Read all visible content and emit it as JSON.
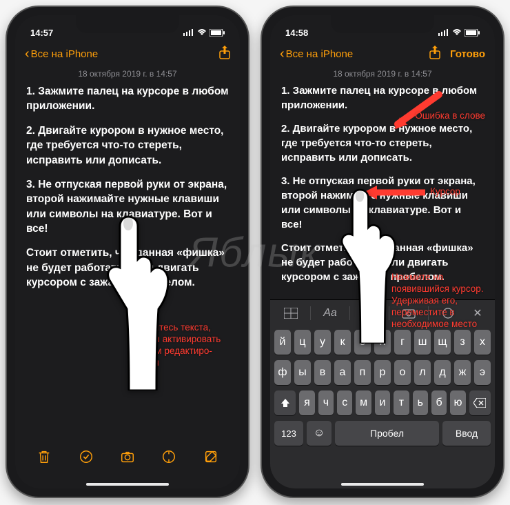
{
  "status": {
    "time1": "14:57",
    "time2": "14:58"
  },
  "nav": {
    "back": "Все на iPhone",
    "done": "Готово"
  },
  "note": {
    "date": "18 октября 2019 г. в 14:57",
    "p1": "1. Зажмите палец на курсоре в любом приложении.",
    "p2": "2. Двигайте курором в нужное место, где требуется что-то стереть, исправить или дописать.",
    "p3": "3. Не отпуская первой руки от экрана, второй нажимайте нужные клавиши или символы на клавиатуре. Вот и все!",
    "p4": "Стоит отметить, что данная «фишка» не будет работать, если двигать курсором с зажатым пробелом."
  },
  "anno": {
    "left": "Коснитесь текста, чтобы активировать режим редактиро-\nвания",
    "err": "Ошибка в слове",
    "cur": "Курсор",
    "right": "Нажмите на появившийся курсор. Удерживая его, переместите в необходимое место"
  },
  "keyboard": {
    "row1": [
      "й",
      "ц",
      "у",
      "к",
      "е",
      "н",
      "г",
      "ш",
      "щ",
      "з",
      "х"
    ],
    "row2": [
      "ф",
      "ы",
      "в",
      "а",
      "п",
      "р",
      "о",
      "л",
      "д",
      "ж",
      "э"
    ],
    "row3": [
      "я",
      "ч",
      "с",
      "м",
      "и",
      "т",
      "ь",
      "б",
      "ю"
    ],
    "k123": "123",
    "space": "Пробел",
    "enter": "Ввод"
  },
  "watermark": "Яблык"
}
